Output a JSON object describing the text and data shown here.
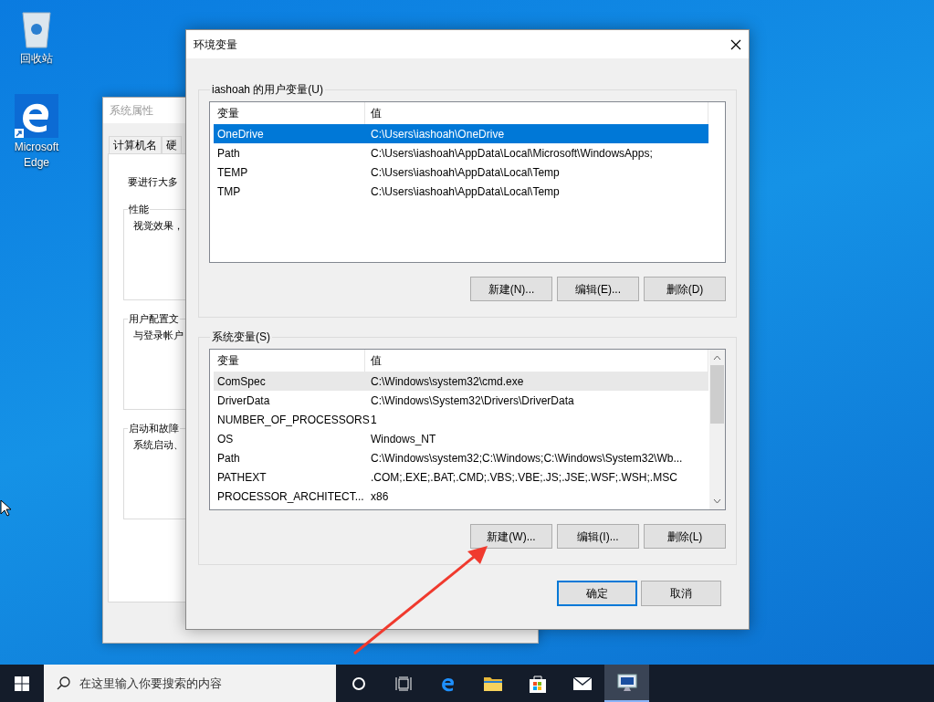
{
  "desktop_icons": [
    {
      "label": "回收站",
      "kind": "recycle-bin"
    },
    {
      "label": "Microsoft Edge",
      "kind": "edge"
    }
  ],
  "background_window": {
    "title": "系统属性",
    "tabs": [
      {
        "label": "计算机名",
        "selected": false
      },
      {
        "label": "硬",
        "selected": false
      }
    ],
    "intro": "要进行大多",
    "groups": [
      {
        "title": "性能",
        "text": "视觉效果，"
      },
      {
        "title": "用户配置文",
        "text": "与登录帐户"
      },
      {
        "title": "启动和故障",
        "text": "系统启动、"
      }
    ]
  },
  "dialog": {
    "title": "环境变量",
    "user_variables": {
      "title": "iashoah 的用户变量(U)",
      "focused": true,
      "columns": [
        "变量",
        "值"
      ],
      "rows": [
        {
          "name": "OneDrive",
          "value": "C:\\Users\\iashoah\\OneDrive",
          "selected": true
        },
        {
          "name": "Path",
          "value": "C:\\Users\\iashoah\\AppData\\Local\\Microsoft\\WindowsApps;",
          "selected": false
        },
        {
          "name": "TEMP",
          "value": "C:\\Users\\iashoah\\AppData\\Local\\Temp",
          "selected": false
        },
        {
          "name": "TMP",
          "value": "C:\\Users\\iashoah\\AppData\\Local\\Temp",
          "selected": false
        }
      ],
      "buttons": [
        "新建(N)...",
        "编辑(E)...",
        "删除(D)"
      ]
    },
    "system_variables": {
      "title": "系统变量(S)",
      "focused": false,
      "columns": [
        "变量",
        "值"
      ],
      "rows": [
        {
          "name": "ComSpec",
          "value": "C:\\Windows\\system32\\cmd.exe",
          "selected": true
        },
        {
          "name": "DriverData",
          "value": "C:\\Windows\\System32\\Drivers\\DriverData",
          "selected": false
        },
        {
          "name": "NUMBER_OF_PROCESSORS",
          "value": "1",
          "selected": false
        },
        {
          "name": "OS",
          "value": "Windows_NT",
          "selected": false
        },
        {
          "name": "Path",
          "value": "C:\\Windows\\system32;C:\\Windows;C:\\Windows\\System32\\Wb...",
          "selected": false
        },
        {
          "name": "PATHEXT",
          "value": ".COM;.EXE;.BAT;.CMD;.VBS;.VBE;.JS;.JSE;.WSF;.WSH;.MSC",
          "selected": false
        },
        {
          "name": "PROCESSOR_ARCHITECT...",
          "value": "x86",
          "selected": false
        }
      ],
      "buttons": [
        "新建(W)...",
        "编辑(I)...",
        "删除(L)"
      ]
    },
    "buttons": [
      {
        "label": "确定",
        "default": true
      },
      {
        "label": "取消",
        "default": false
      }
    ]
  },
  "taskbar": {
    "search": {
      "placeholder": "在这里输入你要搜索的内容"
    },
    "apps": [
      {
        "kind": "cortana",
        "active": false
      },
      {
        "kind": "task-view",
        "active": false
      },
      {
        "kind": "edge",
        "active": false
      },
      {
        "kind": "folder",
        "active": false
      },
      {
        "kind": "store",
        "active": false
      },
      {
        "kind": "mail",
        "active": false
      },
      {
        "kind": "monitor",
        "active": true
      }
    ]
  }
}
